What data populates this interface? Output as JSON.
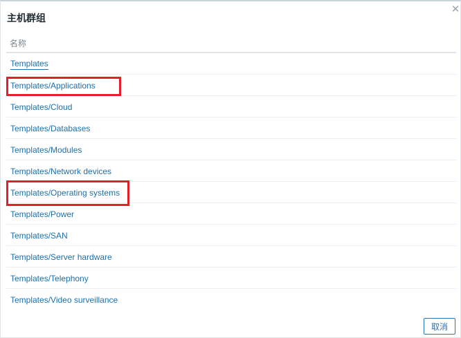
{
  "dialog": {
    "title": "主机群组",
    "close_icon": "✕",
    "column_header": "名称",
    "cancel_label": "取消"
  },
  "groups": [
    "Templates",
    "Templates/Applications",
    "Templates/Cloud",
    "Templates/Databases",
    "Templates/Modules",
    "Templates/Network devices",
    "Templates/Operating systems",
    "Templates/Power",
    "Templates/SAN",
    "Templates/Server hardware",
    "Templates/Telephony",
    "Templates/Video surveillance"
  ],
  "highlighted": [
    "Templates/Applications",
    "Templates/Operating systems"
  ],
  "colors": {
    "link": "#1f6fa8",
    "highlight": "#e0202b",
    "button": "#2f73ab"
  }
}
